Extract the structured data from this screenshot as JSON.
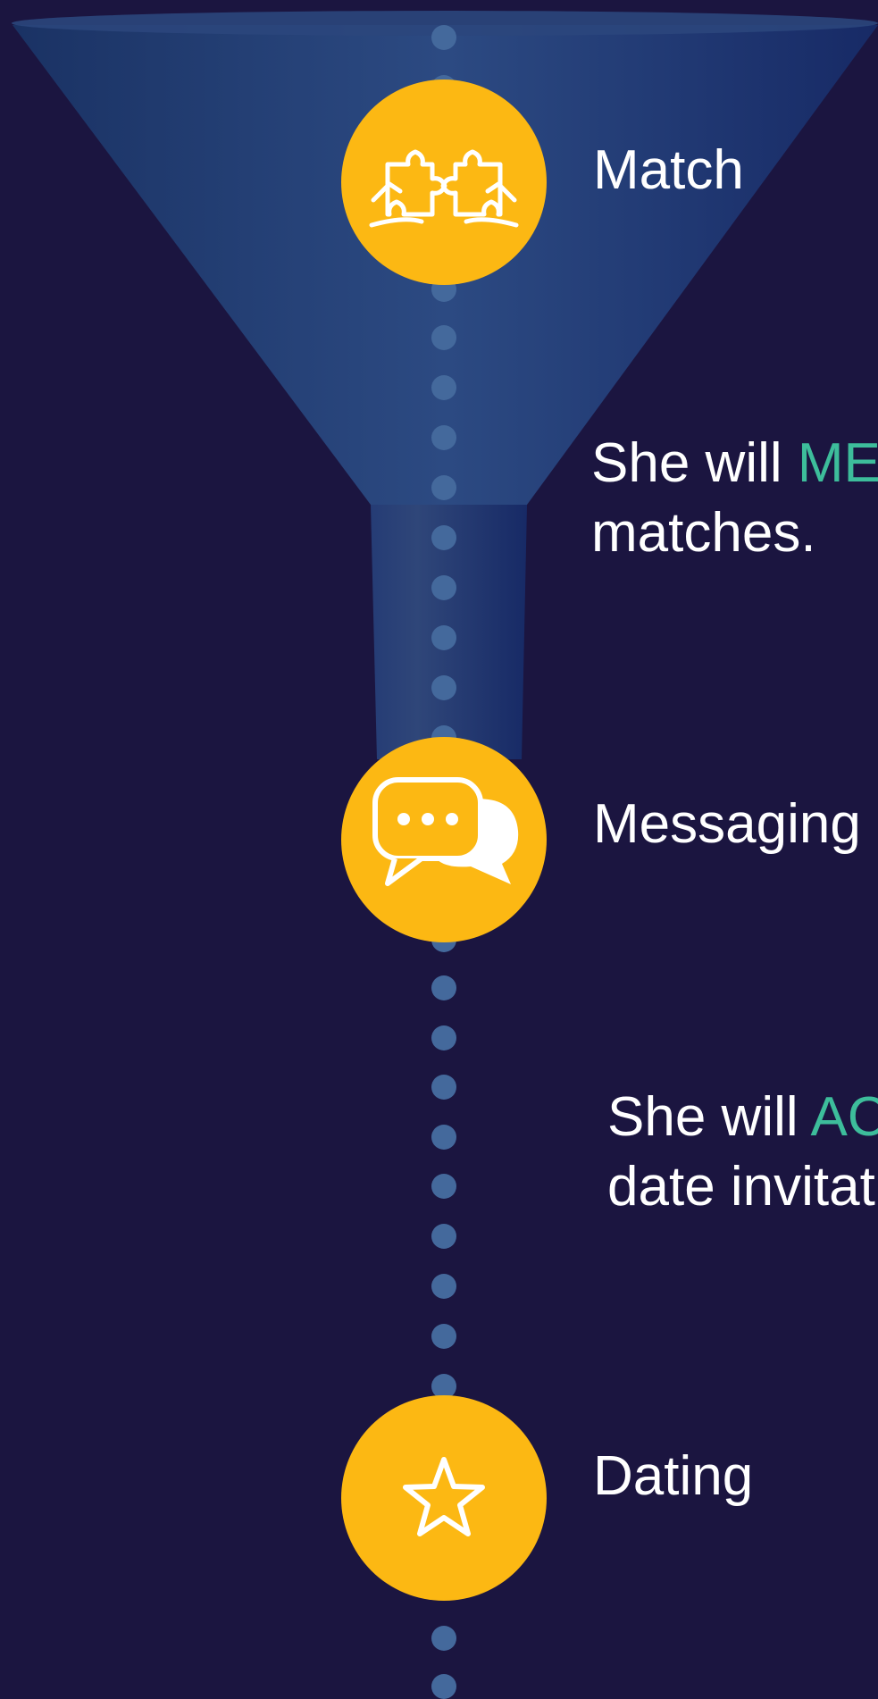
{
  "colors": {
    "background": "#1b1540",
    "funnel": "#1d3a74",
    "dots": "#44699c",
    "circle": "#fcb813",
    "text": "#ffffff",
    "highlight": "#3dbd9b"
  },
  "stages": [
    {
      "label": "Match",
      "icon": "puzzle-pieces-icon"
    },
    {
      "label": "Messaging",
      "icon": "chat-bubbles-icon"
    },
    {
      "label": "Dating",
      "icon": "star-icon"
    }
  ],
  "descriptions": [
    {
      "prefix": "She will ",
      "highlight": "ME",
      "line2": "matches."
    },
    {
      "prefix": "She will ",
      "highlight": "AC",
      "line2": "date invitat"
    }
  ]
}
